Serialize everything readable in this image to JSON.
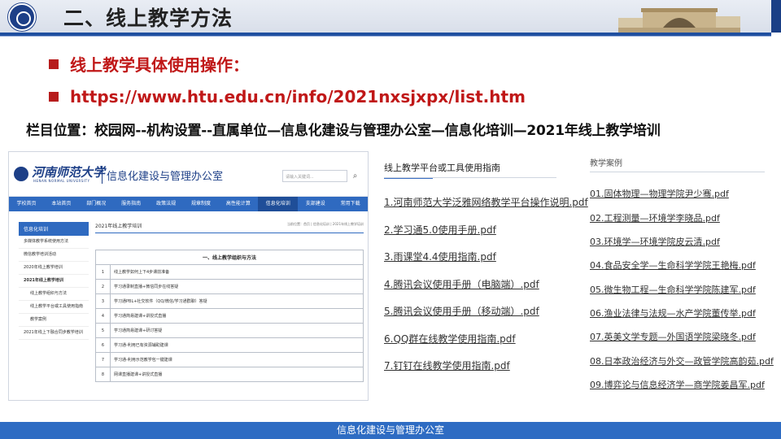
{
  "header": {
    "title": "二、线上教学方法"
  },
  "bullets": [
    "线上教学具体使用操作：",
    "https://www.htu.edu.cn/info/2021nxsjxpx/list.htm"
  ],
  "location": "栏目位置：校园网--机构设置--直属单位—信息化建设与管理办公室—信息化培训—2021年线上教学培训",
  "site": {
    "name": "河南师范大学",
    "name_en": "HENAN NORMAL UNIVERSITY",
    "dept": "信息化建设与管理办公室",
    "search_placeholder": "请输入关键词...",
    "nav": [
      "学校首页",
      "本站首页",
      "部门概况",
      "服务指南",
      "政策法规",
      "规章制度",
      "高性能计算",
      "信息化培训",
      "支部建设",
      "常用下载"
    ],
    "side_head": "信息化培训",
    "side_items": [
      {
        "label": "多媒体教学系统使用方法",
        "type": ""
      },
      {
        "label": "微信教学培训活动",
        "type": ""
      },
      {
        "label": "2020年线上教学培训",
        "type": ""
      },
      {
        "label": "2021年线上教学培训",
        "type": "bold"
      },
      {
        "label": "线上教学组织与方法",
        "type": "sub"
      },
      {
        "label": "线上教学平台或工具使用指南",
        "type": "sub"
      },
      {
        "label": "教学案例",
        "type": "sub"
      },
      {
        "label": "2021年线上下融合同步教学培训",
        "type": ""
      }
    ],
    "main_title": "2021年线上教学培训",
    "crumb": "当前位置：首页 | 信息化培训 | 2021年线上教学培训",
    "table_head": "一、线上教学组织与方法",
    "rows": [
      {
        "n": "1",
        "text": "线上教学如何上下4步课前准备"
      },
      {
        "n": "2",
        "text": "学习通录制直播+微信同步在线答疑"
      },
      {
        "n": "3",
        "text": "学习通PBL+社交软件（QQ/微信/学习通群聊）答疑"
      },
      {
        "n": "4",
        "text": "学习通简易建课+讲授式直播"
      },
      {
        "n": "5",
        "text": "学习通简易建课+研讨答疑"
      },
      {
        "n": "6",
        "text": "学习通-利用已有资源辅助建课"
      },
      {
        "n": "7",
        "text": "学习通-利用示范教学包一键建课"
      },
      {
        "n": "8",
        "text": "网课直播建课+讲授式直播"
      }
    ]
  },
  "guides": {
    "heading": "线上教学平台或工具使用指南",
    "links": [
      "1.河南师范大学泛雅网络教学平台操作说明.pdf",
      "2.学习通5.0使用手册.pdf",
      "3.雨课堂4.4使用指南.pdf",
      "4.腾讯会议使用手册（电脑端）.pdf",
      "5.腾讯会议使用手册（移动端）.pdf",
      "6.QQ群在线教学使用指南.pdf",
      "7.钉钉在线教学使用指南.pdf"
    ]
  },
  "cases": {
    "heading": "教学案例",
    "links": [
      "01.固体物理—物理学院尹少骞.pdf",
      "02.工程测量—环境学李晓品.pdf",
      "03.环境学—环境学院皮云清.pdf",
      "04.食品安全学—生命科学学院王艳梅.pdf",
      "05.微生物工程—生命科学学院陈建军.pdf",
      "06.渔业法律与法规—水产学院董传举.pdf",
      "07.英美文学专题—外国语学院梁晓冬.pdf",
      "08.日本政治经济与外交—政管学院高韵茹.pdf",
      "09.博弈论与信息经济学—商学院姜昌军.pdf"
    ]
  },
  "footer": "信息化建设与管理办公室",
  "colors": {
    "accent_red": "#c01818",
    "primary_blue": "#2e6cc3",
    "dark_blue": "#1d3f87"
  }
}
